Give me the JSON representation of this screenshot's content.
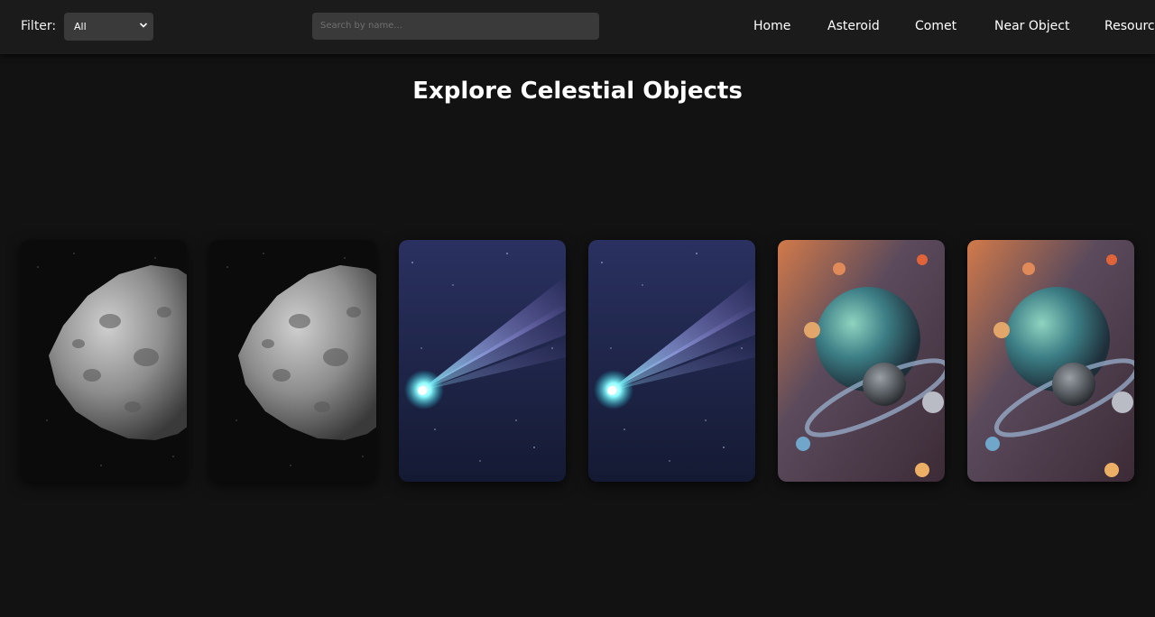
{
  "navbar": {
    "filter_label": "Filter:",
    "filter_value": "All",
    "search_placeholder": "Search by name...",
    "links": [
      "Home",
      "Asteroid",
      "Comet",
      "Near Object",
      "Resources"
    ]
  },
  "main": {
    "title": "Explore Celestial Objects",
    "cards": [
      {
        "image": "asteroid-image"
      },
      {
        "image": "asteroid-image"
      },
      {
        "image": "comet-image"
      },
      {
        "image": "comet-image"
      },
      {
        "image": "planet-image"
      },
      {
        "image": "planet-image"
      }
    ]
  },
  "colors": {
    "background": "#121212",
    "navbar": "#1b1b1b",
    "input": "#3a3a3a",
    "text": "#ffffff"
  }
}
